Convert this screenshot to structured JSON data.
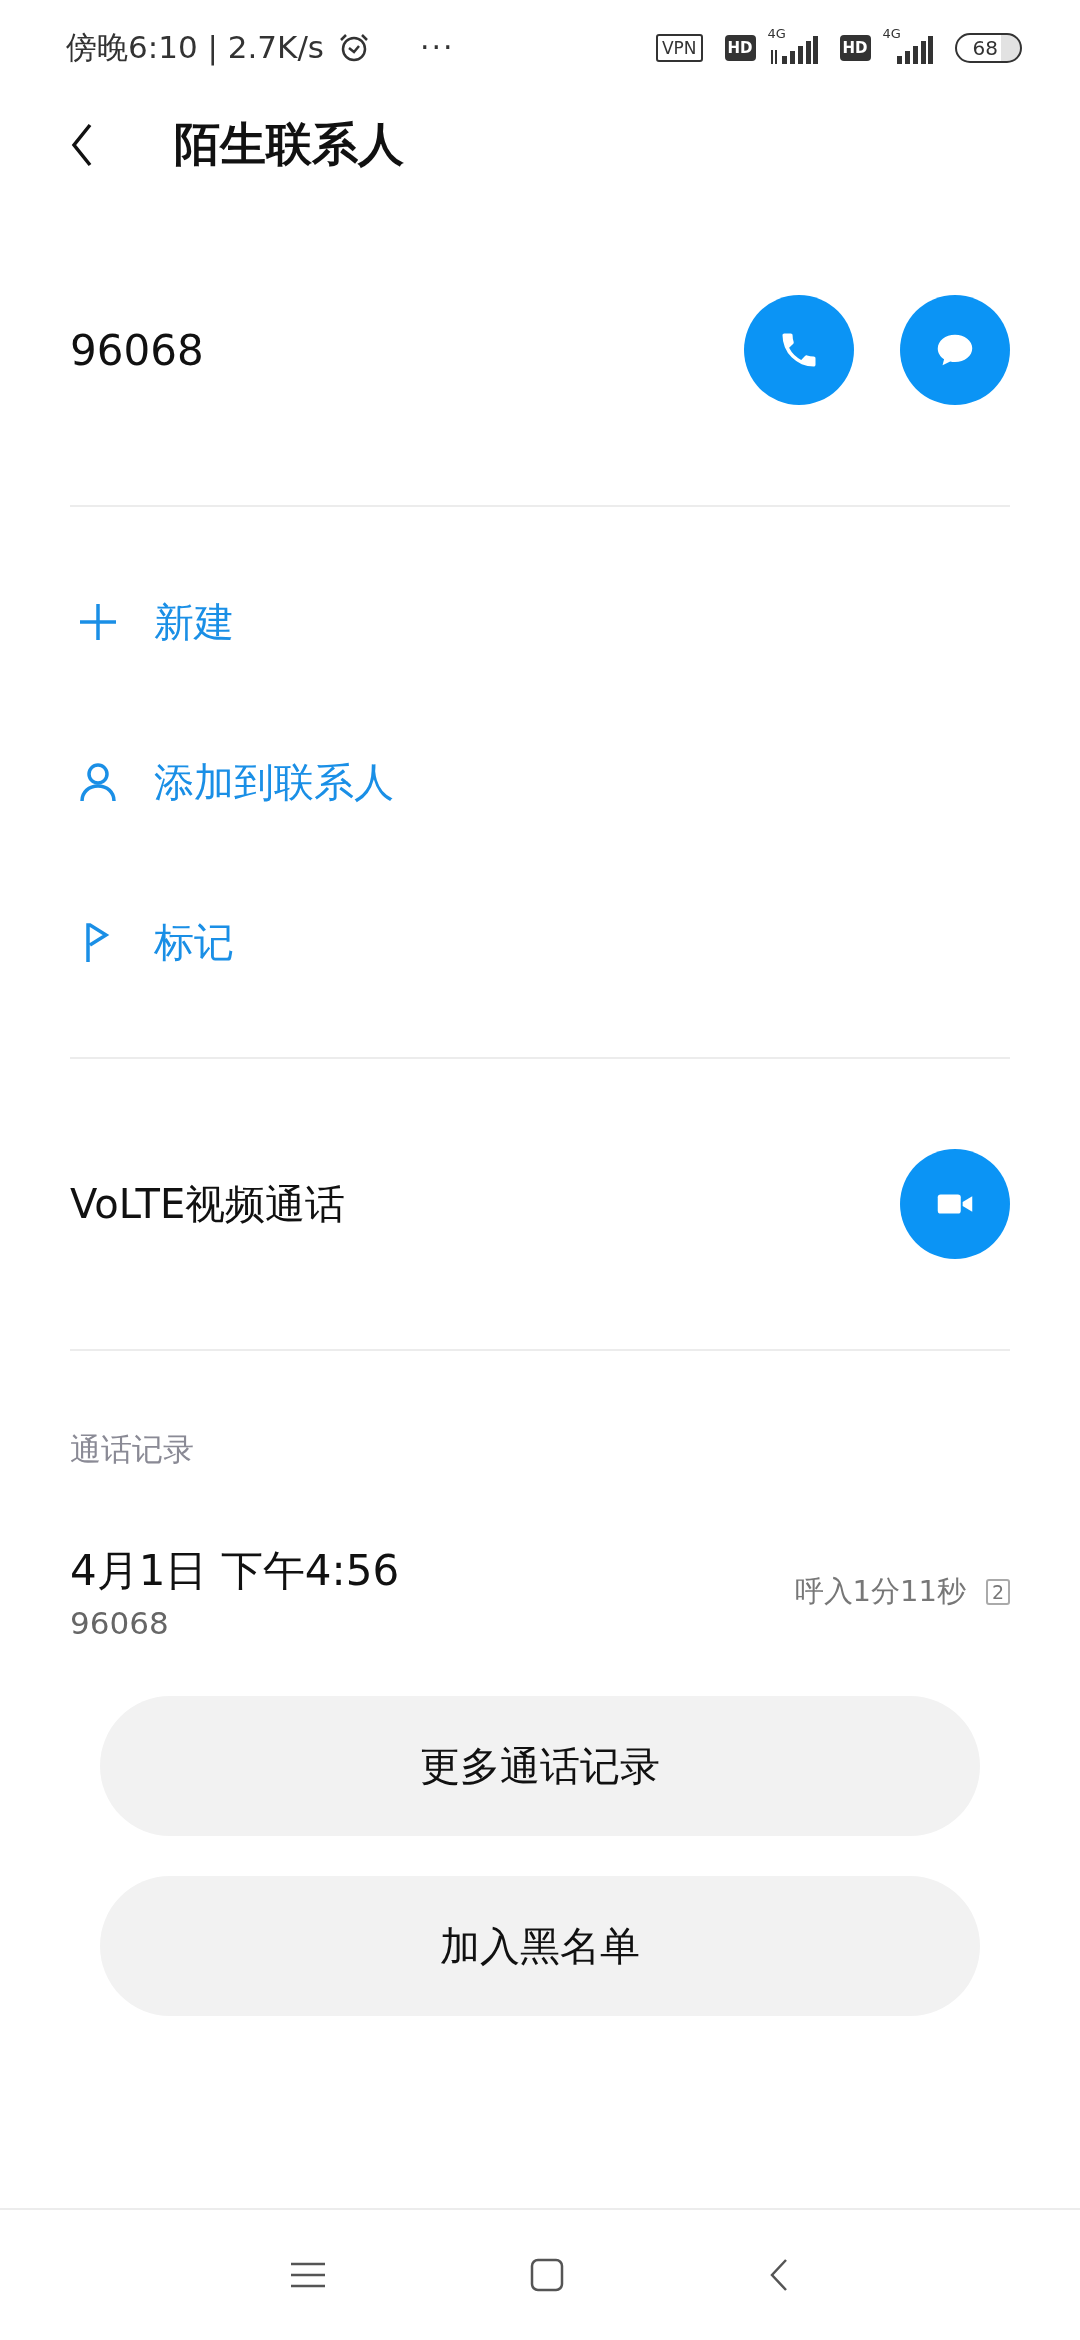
{
  "status_bar": {
    "time": "傍晚6:10 | 2.7K/s",
    "more": "···",
    "vpn": "VPN",
    "sims": [
      {
        "hd": "HD",
        "network": "4G",
        "arrows": true
      },
      {
        "hd": "HD",
        "network": "4G",
        "arrows": false
      }
    ],
    "battery": "68"
  },
  "header": {
    "title": "陌生联系人"
  },
  "contact": {
    "number": "96068"
  },
  "actions": [
    {
      "kind": "add",
      "label": "新建"
    },
    {
      "kind": "person",
      "label": "添加到联系人"
    },
    {
      "kind": "flag",
      "label": "标记"
    }
  ],
  "video_call": {
    "label": "VoLTE视频通话"
  },
  "call_log": {
    "heading": "通话记录",
    "entries": [
      {
        "datetime": "4月1日 下午4:56",
        "number": "96068",
        "detail": "呼入1分11秒",
        "sim": "2"
      }
    ]
  },
  "buttons": [
    "更多通话记录",
    "加入黑名单"
  ]
}
